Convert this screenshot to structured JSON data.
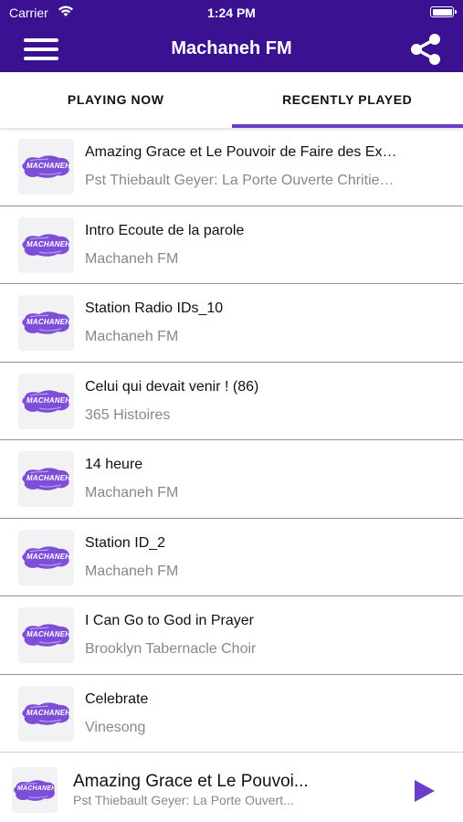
{
  "status_bar": {
    "carrier": "Carrier",
    "time": "1:24 PM"
  },
  "nav": {
    "title": "Machaneh FM",
    "menu_icon": "hamburger-menu-icon",
    "share_icon": "share-icon"
  },
  "tabs": [
    {
      "label": "PLAYING NOW",
      "active": false
    },
    {
      "label": "RECENTLY PLAYED",
      "active": true
    }
  ],
  "logo_text": "MACHANEH FM",
  "tracks": [
    {
      "title": "Amazing Grace et Le Pouvoir de Faire des Ex…",
      "artist": "Pst Thiebault Geyer: La Porte Ouverte Chritie…"
    },
    {
      "title": "Intro Ecoute de la parole",
      "artist": "Machaneh FM"
    },
    {
      "title": "Station Radio IDs_10",
      "artist": "Machaneh FM"
    },
    {
      "title": "Celui qui devait venir ! (86)",
      "artist": "365 Histoires"
    },
    {
      "title": "14  heure",
      "artist": "Machaneh FM"
    },
    {
      "title": "Station ID_2",
      "artist": "Machaneh FM"
    },
    {
      "title": "I Can Go to God in Prayer",
      "artist": "Brooklyn Tabernacle Choir"
    },
    {
      "title": "Celebrate",
      "artist": "Vinesong"
    }
  ],
  "now_playing": {
    "title": "Amazing Grace et Le Pouvoi...",
    "artist": "Pst Thiebault Geyer: La Porte Ouvert...",
    "play_icon": "play-icon"
  },
  "colors": {
    "header": "#3a1190",
    "accent": "#6a3ec8",
    "logo_purple": "#7e4fd6"
  }
}
